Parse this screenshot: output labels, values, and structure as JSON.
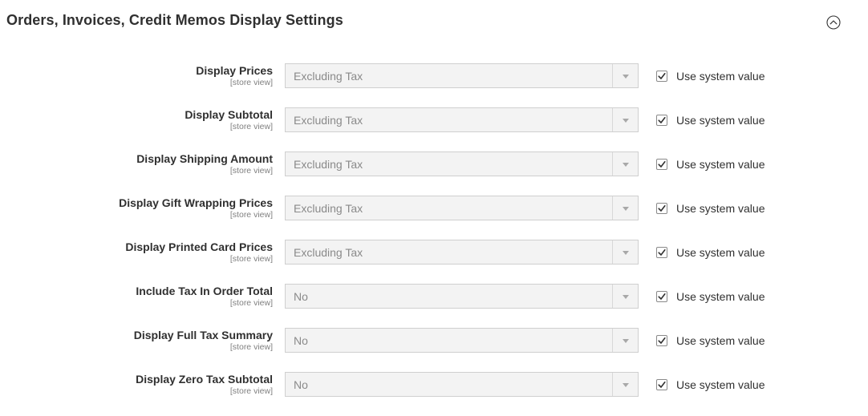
{
  "section": {
    "title": "Orders, Invoices, Credit Memos Display Settings",
    "toggle_icon": "chevron-up-circle-icon"
  },
  "rows": [
    {
      "label": "Display Prices",
      "scope": "[store view]",
      "value": "Excluding Tax",
      "use_system_label": "Use system value",
      "use_system_checked": true
    },
    {
      "label": "Display Subtotal",
      "scope": "[store view]",
      "value": "Excluding Tax",
      "use_system_label": "Use system value",
      "use_system_checked": true
    },
    {
      "label": "Display Shipping Amount",
      "scope": "[store view]",
      "value": "Excluding Tax",
      "use_system_label": "Use system value",
      "use_system_checked": true
    },
    {
      "label": "Display Gift Wrapping Prices",
      "scope": "[store view]",
      "value": "Excluding Tax",
      "use_system_label": "Use system value",
      "use_system_checked": true
    },
    {
      "label": "Display Printed Card Prices",
      "scope": "[store view]",
      "value": "Excluding Tax",
      "use_system_label": "Use system value",
      "use_system_checked": true
    },
    {
      "label": "Include Tax In Order Total",
      "scope": "[store view]",
      "value": "No",
      "use_system_label": "Use system value",
      "use_system_checked": true
    },
    {
      "label": "Display Full Tax Summary",
      "scope": "[store view]",
      "value": "No",
      "use_system_label": "Use system value",
      "use_system_checked": true
    },
    {
      "label": "Display Zero Tax Subtotal",
      "scope": "[store view]",
      "value": "No",
      "use_system_label": "Use system value",
      "use_system_checked": true
    }
  ]
}
